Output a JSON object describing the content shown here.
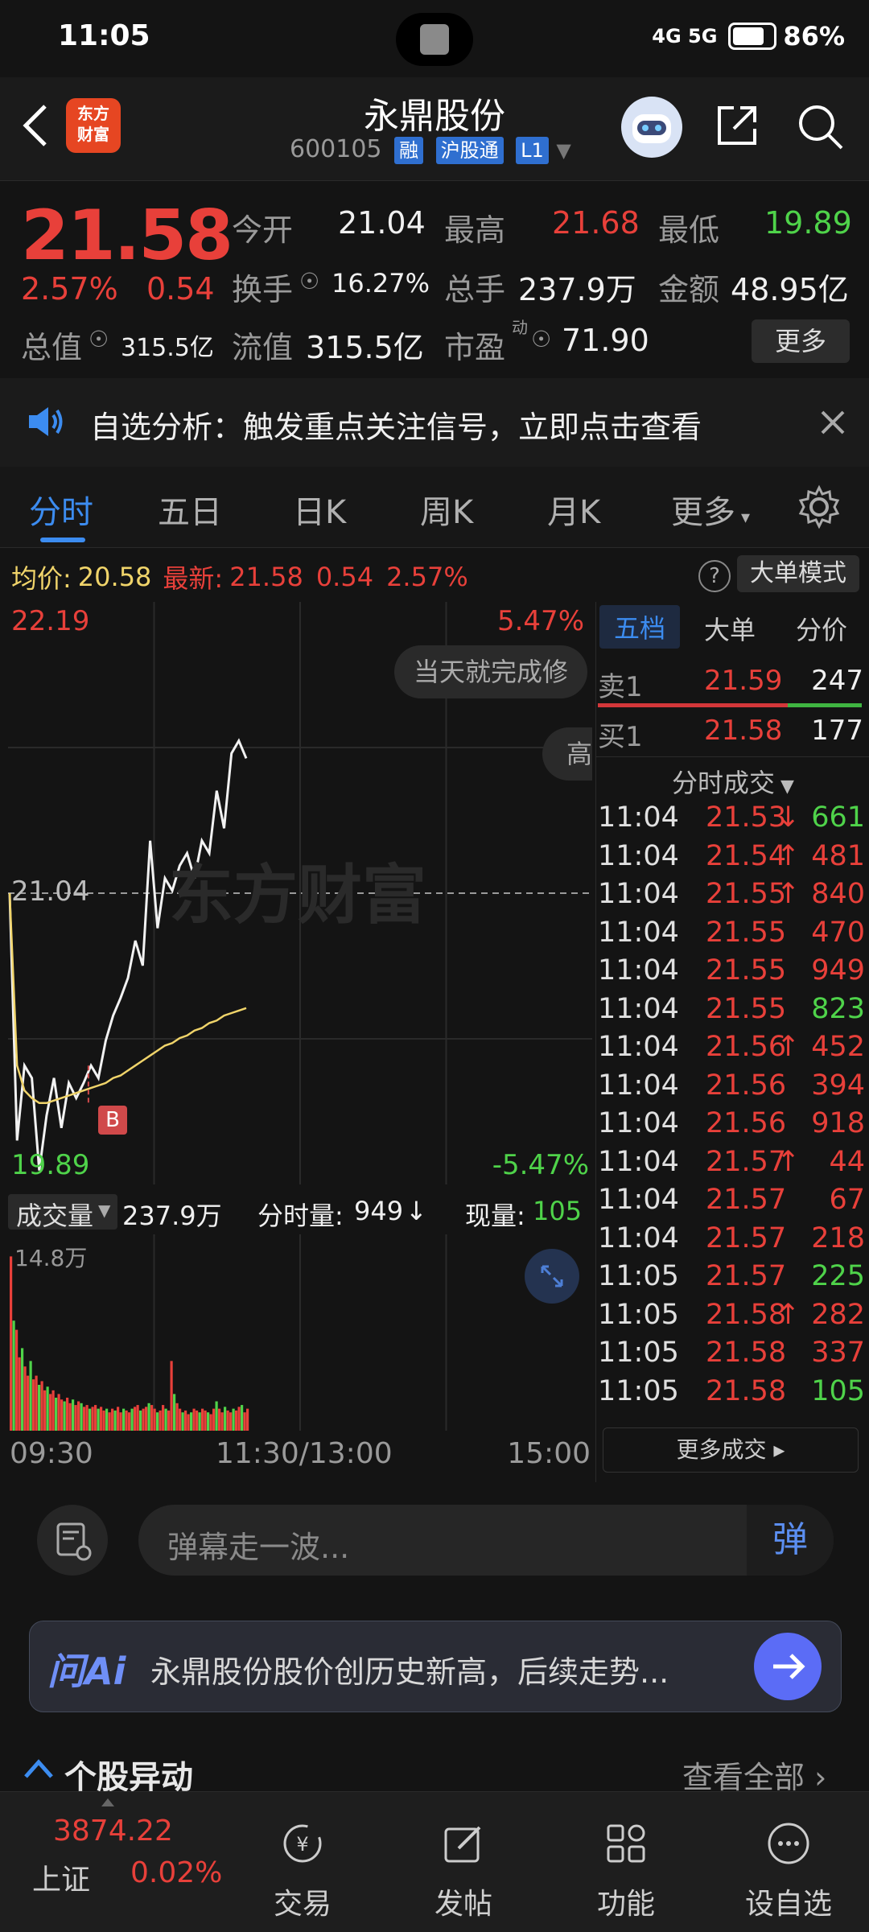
{
  "status_bar": {
    "time": "11:05",
    "network": "4G 5G",
    "battery": "86%"
  },
  "header": {
    "logo_text": "东方财富",
    "stock_name": "永鼎股份",
    "stock_code": "600105",
    "tags": [
      "融",
      "沪股通",
      "L1"
    ]
  },
  "quote": {
    "price": "21.58",
    "change_pct": "2.57%",
    "change": "0.54",
    "fields": {
      "open_label": "今开",
      "open": "21.04",
      "high_label": "最高",
      "high": "21.68",
      "low_label": "最低",
      "low": "19.89",
      "turnover_label": "换手",
      "turnover": "16.27%",
      "volume_label": "总手",
      "volume": "237.9万",
      "amount_label": "金额",
      "amount": "48.95亿",
      "mktcap_label": "总值",
      "mktcap": "315.5亿",
      "float_label": "流值",
      "float_cap": "315.5亿",
      "pe_label": "市盈",
      "pe_sup": "动",
      "pe": "71.90"
    },
    "more_label": "更多"
  },
  "banner": {
    "text": "自选分析：触发重点关注信号，立即点击查看"
  },
  "tabs": [
    "分时",
    "五日",
    "日K",
    "周K",
    "月K",
    "更多"
  ],
  "info_line": {
    "avg_label": "均价:",
    "avg_value": "20.58",
    "latest_label": "最新:",
    "latest_value": "21.58",
    "latest_change": "0.54",
    "latest_pct": "2.57%",
    "help": "?",
    "big_order_mode": "大单模式"
  },
  "chart": {
    "top_price": "22.19",
    "top_pct": "5.47%",
    "mid_price": "21.04",
    "bottom_price": "19.89",
    "bottom_pct": "-5.47%",
    "watermark": "东方财富",
    "tooltip_1": "当天就完成修",
    "tooltip_2": "高",
    "marker_b": "B",
    "colors": {
      "price_line": "#f2f2f2",
      "avg_line": "#f0d46a",
      "up": "#e8403a",
      "down": "#4fd34a"
    }
  },
  "chart_data": {
    "type": "line",
    "x": [
      "09:30",
      "09:33",
      "09:36",
      "09:39",
      "09:42",
      "09:45",
      "09:48",
      "09:51",
      "09:54",
      "09:57",
      "10:00",
      "10:03",
      "10:06",
      "10:09",
      "10:12",
      "10:15",
      "10:18",
      "10:21",
      "10:24",
      "10:27",
      "10:30",
      "10:33",
      "10:36",
      "10:39",
      "10:42",
      "10:45",
      "10:48",
      "10:51",
      "10:54",
      "10:57",
      "11:00",
      "11:03",
      "11:05"
    ],
    "series": [
      {
        "values": [
          21.04,
          20.05,
          20.35,
          20.3,
          19.93,
          20.15,
          20.3,
          20.1,
          20.28,
          20.22,
          20.28,
          20.35,
          20.3,
          20.45,
          20.55,
          20.62,
          20.7,
          20.85,
          20.75,
          21.25,
          20.9,
          21.1,
          21.05,
          21.15,
          21.2,
          21.1,
          21.25,
          21.2,
          21.45,
          21.3,
          21.6,
          21.65,
          21.58
        ]
      },
      {
        "values": [
          21.04,
          20.35,
          20.25,
          20.22,
          20.2,
          20.2,
          20.21,
          20.22,
          20.23,
          20.24,
          20.25,
          20.26,
          20.27,
          20.28,
          20.3,
          20.31,
          20.33,
          20.35,
          20.37,
          20.39,
          20.41,
          20.43,
          20.44,
          20.46,
          20.47,
          20.49,
          20.5,
          20.52,
          20.53,
          20.55,
          20.56,
          20.57,
          20.58
        ]
      }
    ],
    "ylim": [
      19.89,
      22.19
    ],
    "x_ticks": [
      "09:30",
      "11:30/13:00",
      "15:00"
    ]
  },
  "volume": {
    "label": "成交量",
    "total": "237.9万",
    "tick_label": "分时量:",
    "tick_value": "949",
    "tick_arrow": "↓",
    "current_label": "现量:",
    "current_value": "105",
    "max_label": "14.8万",
    "bars": [
      0.95,
      0.6,
      0.55,
      0.4,
      0.45,
      0.35,
      0.3,
      0.38,
      0.28,
      0.3,
      0.25,
      0.27,
      0.22,
      0.24,
      0.2,
      0.22,
      0.18,
      0.2,
      0.17,
      0.16,
      0.18,
      0.15,
      0.17,
      0.14,
      0.16,
      0.15,
      0.13,
      0.14,
      0.12,
      0.13,
      0.14,
      0.12,
      0.13,
      0.11,
      0.12,
      0.1,
      0.12,
      0.11,
      0.13,
      0.1,
      0.12,
      0.11,
      0.1,
      0.12,
      0.13,
      0.14,
      0.11,
      0.12,
      0.13,
      0.15,
      0.14,
      0.12,
      0.1,
      0.11,
      0.14,
      0.12,
      0.11,
      0.38,
      0.2,
      0.15,
      0.12,
      0.1,
      0.11,
      0.09,
      0.1,
      0.12,
      0.11,
      0.1,
      0.12,
      0.11,
      0.1,
      0.09,
      0.12,
      0.16,
      0.12,
      0.1,
      0.13,
      0.11,
      0.1,
      0.12,
      0.11,
      0.13,
      0.14,
      0.1,
      0.12
    ]
  },
  "time_axis": [
    "09:30",
    "11:30/13:00",
    "15:00"
  ],
  "orderbook": {
    "tabs": [
      "五档",
      "大单",
      "分价"
    ],
    "sell1": {
      "label": "卖1",
      "price": "21.59",
      "vol": "247"
    },
    "buy1": {
      "label": "买1",
      "price": "21.58",
      "vol": "177"
    },
    "trades_title": "分时成交",
    "trades": [
      {
        "time": "11:04",
        "price": "21.53",
        "arrow": "↓",
        "vol": "661",
        "dir": "down"
      },
      {
        "time": "11:04",
        "price": "21.54",
        "arrow": "↑",
        "vol": "481",
        "dir": "up"
      },
      {
        "time": "11:04",
        "price": "21.55",
        "arrow": "↑",
        "vol": "840",
        "dir": "up"
      },
      {
        "time": "11:04",
        "price": "21.55",
        "arrow": "",
        "vol": "470",
        "dir": "up"
      },
      {
        "time": "11:04",
        "price": "21.55",
        "arrow": "",
        "vol": "949",
        "dir": "up"
      },
      {
        "time": "11:04",
        "price": "21.55",
        "arrow": "",
        "vol": "823",
        "dir": "down"
      },
      {
        "time": "11:04",
        "price": "21.56",
        "arrow": "↑",
        "vol": "452",
        "dir": "up"
      },
      {
        "time": "11:04",
        "price": "21.56",
        "arrow": "",
        "vol": "394",
        "dir": "up"
      },
      {
        "time": "11:04",
        "price": "21.56",
        "arrow": "",
        "vol": "918",
        "dir": "up"
      },
      {
        "time": "11:04",
        "price": "21.57",
        "arrow": "↑",
        "vol": "44",
        "dir": "up"
      },
      {
        "time": "11:04",
        "price": "21.57",
        "arrow": "",
        "vol": "67",
        "dir": "up"
      },
      {
        "time": "11:04",
        "price": "21.57",
        "arrow": "",
        "vol": "218",
        "dir": "up"
      },
      {
        "time": "11:05",
        "price": "21.57",
        "arrow": "",
        "vol": "225",
        "dir": "down"
      },
      {
        "time": "11:05",
        "price": "21.58",
        "arrow": "↑",
        "vol": "282",
        "dir": "up"
      },
      {
        "time": "11:05",
        "price": "21.58",
        "arrow": "",
        "vol": "337",
        "dir": "up"
      },
      {
        "time": "11:05",
        "price": "21.58",
        "arrow": "",
        "vol": "105",
        "dir": "down"
      }
    ],
    "more_trades": "更多成交 ▸"
  },
  "comment": {
    "placeholder": "弹幕走一波...",
    "danmu_button": "弹"
  },
  "ai": {
    "label": "问Ai",
    "text": "永鼎股份股价创历史新高，后续走势..."
  },
  "section": {
    "title": "个股异动",
    "view_all": "查看全部"
  },
  "bottom_nav": {
    "index_value": "3874.22",
    "index_name": "上证",
    "index_pct": "0.02%",
    "items": [
      "交易",
      "发帖",
      "功能",
      "设自选"
    ]
  }
}
